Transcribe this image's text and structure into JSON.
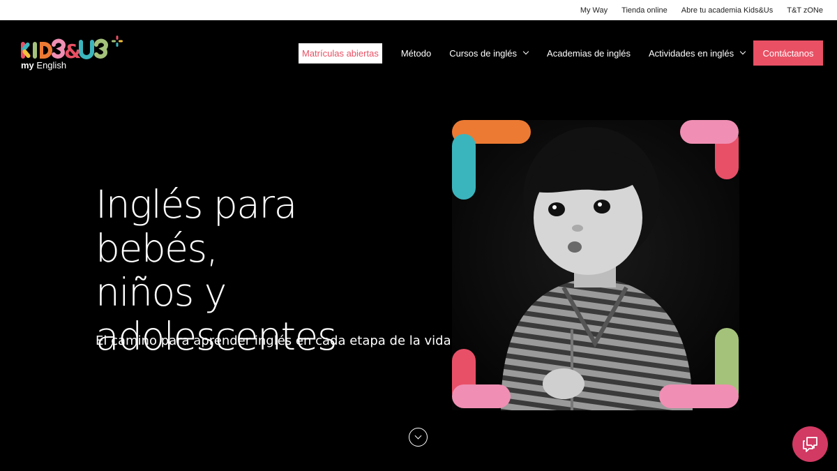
{
  "topbar": {
    "links": [
      "My Way",
      "Tienda online",
      "Abre tu academia Kids&Us",
      "T&T zONe"
    ]
  },
  "logo": {
    "wordmark": "KIDS&US",
    "sub_bold": "my",
    "sub_rest": " English"
  },
  "nav": {
    "enrollment_label": "Matrículas abiertas",
    "items": [
      "Método",
      "Cursos de inglés",
      "Academias de inglés",
      "Actividades en inglés"
    ],
    "contact_label": "Contáctanos"
  },
  "hero": {
    "title_line1": "Inglés para bebés,",
    "title_line2": "niños y",
    "title_line3": "adolescentes",
    "subtitle": "El camino para aprender inglés en cada etapa de la vida"
  },
  "icons": {
    "dropdown": "chevron-down-icon",
    "scroll": "chevron-down-circle-icon",
    "chat": "chat-bubbles-icon"
  },
  "colors": {
    "brand_pink": "#e95064",
    "chat_pink": "#d23a63",
    "frame_orange": "#ec7a33",
    "frame_teal": "#3bb5bd",
    "frame_light_pink": "#f08fb3",
    "frame_red": "#e85068",
    "frame_green": "#a5c27b"
  }
}
